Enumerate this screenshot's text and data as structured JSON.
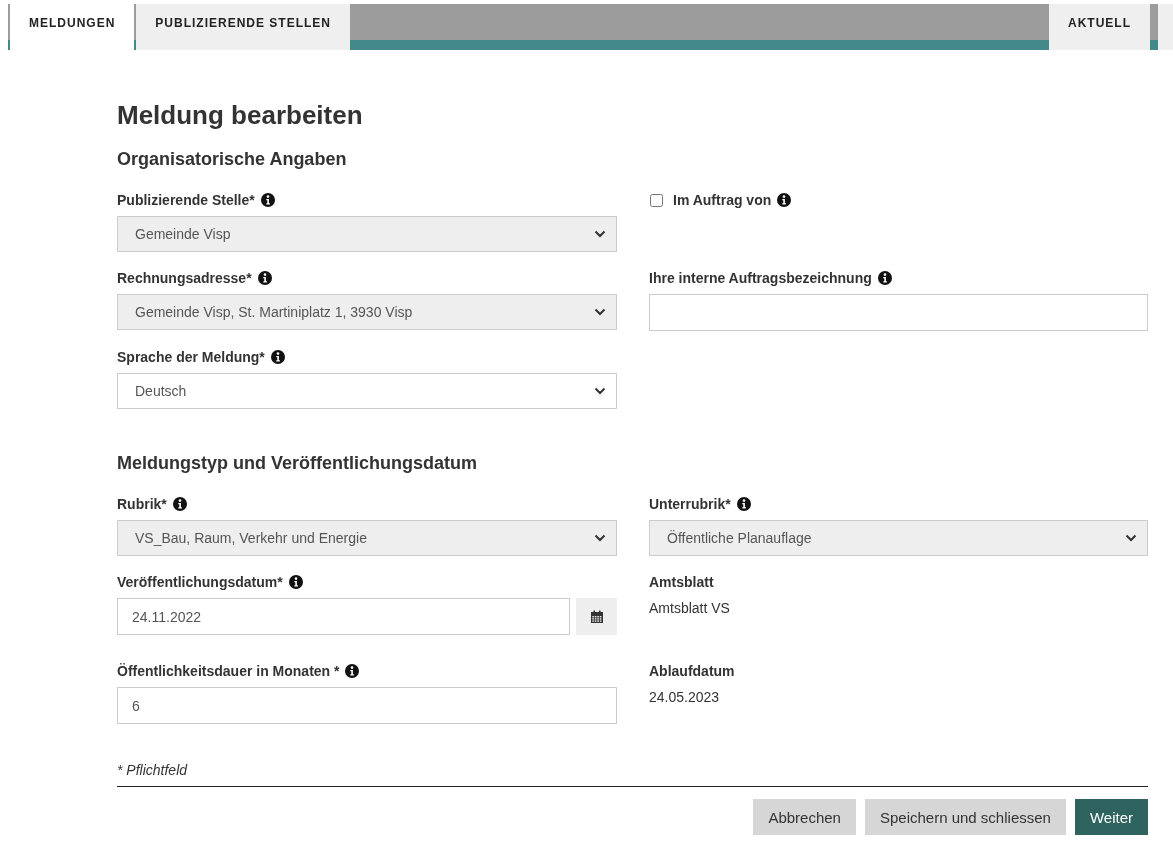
{
  "tabs": [
    {
      "label": "MELDUNGEN",
      "selected": true
    },
    {
      "label": "PUBLIZIERENDE STELLEN",
      "selected": false
    }
  ],
  "right_tabs": [
    {
      "label": "AKTUELL",
      "selected": false
    }
  ],
  "title": "Meldung bearbeiten",
  "sections": [
    {
      "heading": "Organisatorische Angaben",
      "rows": [
        [
          {
            "kind": "select",
            "label": "Publizierende Stelle*",
            "info": true,
            "value": "Gemeinde Visp",
            "disabled": true
          },
          {
            "kind": "checkbox",
            "label": "Im Auftrag von",
            "info": true,
            "checked": false
          }
        ],
        [
          {
            "kind": "select",
            "label": "Rechnungsadresse*",
            "info": true,
            "value": "Gemeinde Visp, St. Martiniplatz 1, 3930 Visp",
            "disabled": true
          },
          {
            "kind": "input",
            "label": "Ihre interne Auftragsbezeichnung",
            "info": true
          }
        ],
        [
          {
            "kind": "select",
            "label": "Sprache der Meldung*",
            "info": true,
            "value": "Deutsch",
            "disabled": false
          }
        ]
      ]
    },
    {
      "heading": "Meldungstyp und Veröffentlichungsdatum",
      "rows": [
        [
          {
            "kind": "select",
            "label": "Rubrik*",
            "info": true,
            "value": "VS_Bau, Raum, Verkehr und Energie",
            "disabled": true
          },
          {
            "kind": "select",
            "label": "Unterrubrik*",
            "info": true,
            "value": "Öffentliche Planauflage",
            "disabled": true
          }
        ],
        [
          {
            "kind": "date",
            "label": "Veröffentlichungsdatum*",
            "info": true,
            "value": "24.11.2022"
          },
          {
            "kind": "static",
            "label": "Amtsblatt",
            "value": "Amtsblatt VS"
          }
        ],
        [
          {
            "kind": "input",
            "label": "Öffentlichkeitsdauer in Monaten *",
            "info": true,
            "value": "6"
          },
          {
            "kind": "static",
            "label": "Ablaufdatum",
            "value": "24.05.2023"
          }
        ]
      ]
    }
  ],
  "footnote": "* Pflichtfeld",
  "buttons": [
    {
      "label": "Abbrechen",
      "kind": "secondary"
    },
    {
      "label": "Speichern und schliessen",
      "kind": "secondary"
    },
    {
      "label": "Weiter",
      "kind": "primary"
    }
  ]
}
